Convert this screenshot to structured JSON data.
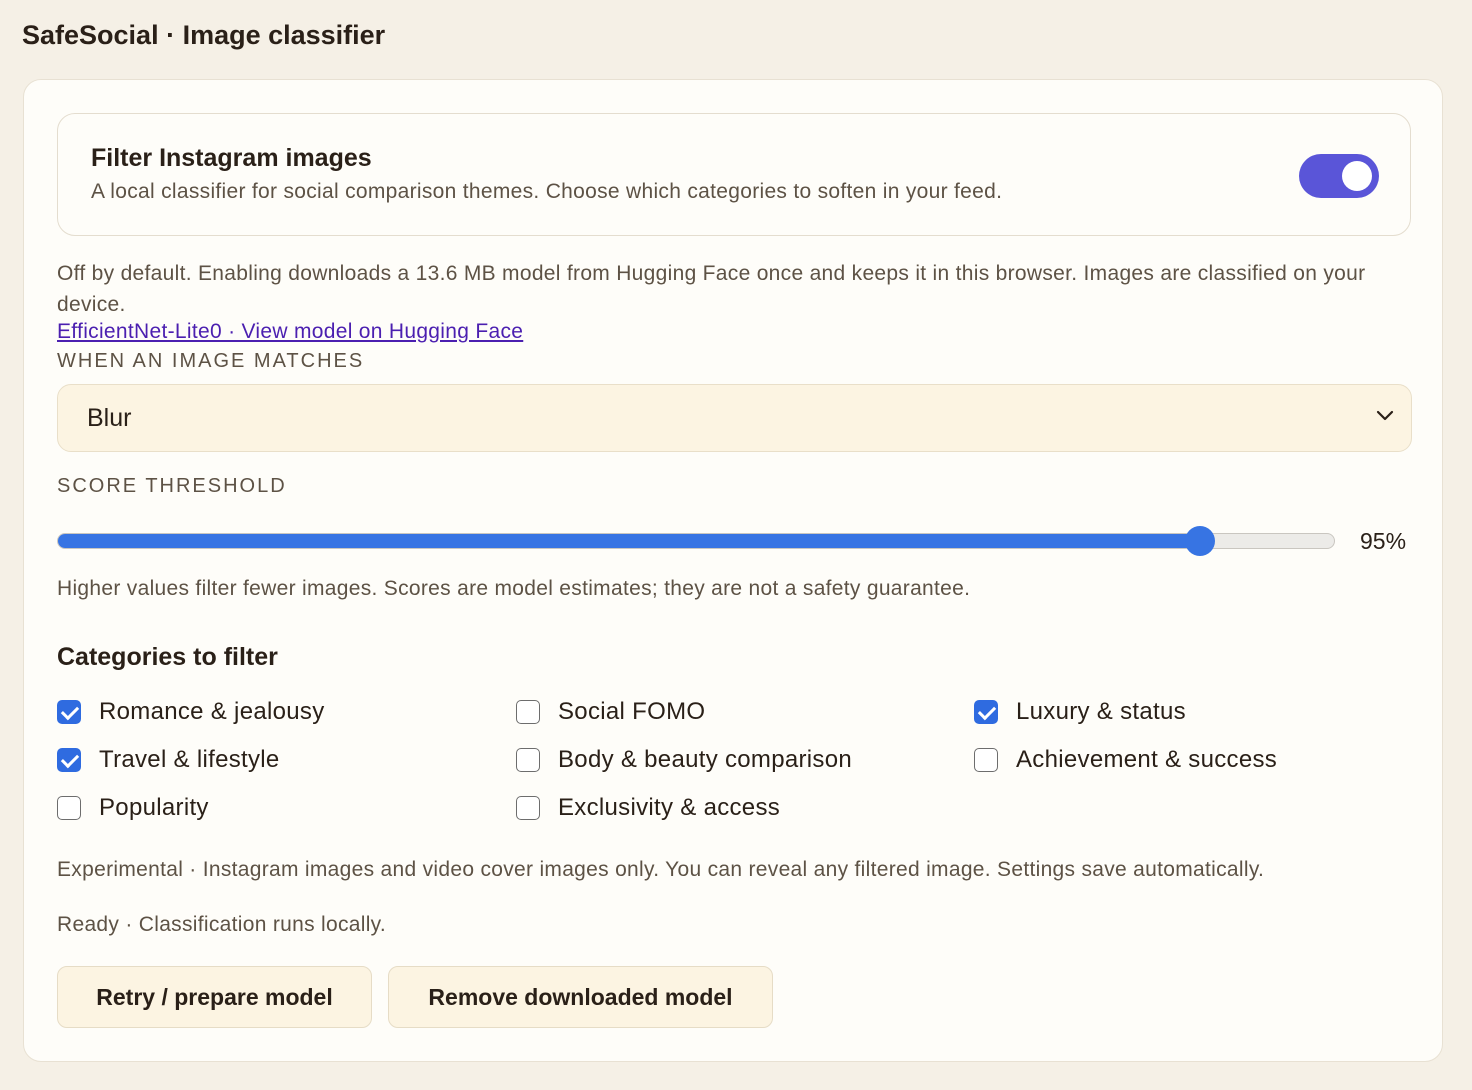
{
  "header": {
    "title": "SafeSocial · Image classifier"
  },
  "toggle": {
    "title": "Filter Instagram images",
    "description": "A local classifier for social comparison themes. Choose which categories to soften in your feed.",
    "enabled": true
  },
  "info": {
    "text": "Off by default. Enabling downloads a 13.6 MB model from Hugging Face once and keeps it in this browser. Images are classified on your device.",
    "link_label": "EfficientNet-Lite0 · View model on Hugging Face"
  },
  "action": {
    "label": "WHEN AN IMAGE MATCHES",
    "selected": "Blur"
  },
  "threshold": {
    "label": "SCORE THRESHOLD",
    "value": 0.895,
    "value_label": "95%",
    "hint": "Higher values filter fewer images. Scores are model estimates; they are not a safety guarantee."
  },
  "categories": {
    "heading": "Categories to filter",
    "items": [
      {
        "label": "Romance & jealousy",
        "checked": true
      },
      {
        "label": "Social FOMO",
        "checked": false
      },
      {
        "label": "Luxury & status",
        "checked": true
      },
      {
        "label": "Travel & lifestyle",
        "checked": true
      },
      {
        "label": "Body & beauty comparison",
        "checked": false
      },
      {
        "label": "Achievement & success",
        "checked": false
      },
      {
        "label": "Popularity",
        "checked": false
      },
      {
        "label": "Exclusivity & access",
        "checked": false
      }
    ]
  },
  "notes": {
    "experimental": "Experimental · Instagram images and video cover images only. You can reveal any filtered image. Settings save automatically.",
    "status": "Ready · Classification runs locally."
  },
  "buttons": {
    "retry": "Retry / prepare model",
    "remove": "Remove downloaded model"
  },
  "colors": {
    "accent_toggle": "#5a55d8",
    "accent_slider": "#3774e3",
    "checkbox_checked": "#2f6be0",
    "background": "#f5f0e6",
    "panel": "#fefdf9"
  }
}
